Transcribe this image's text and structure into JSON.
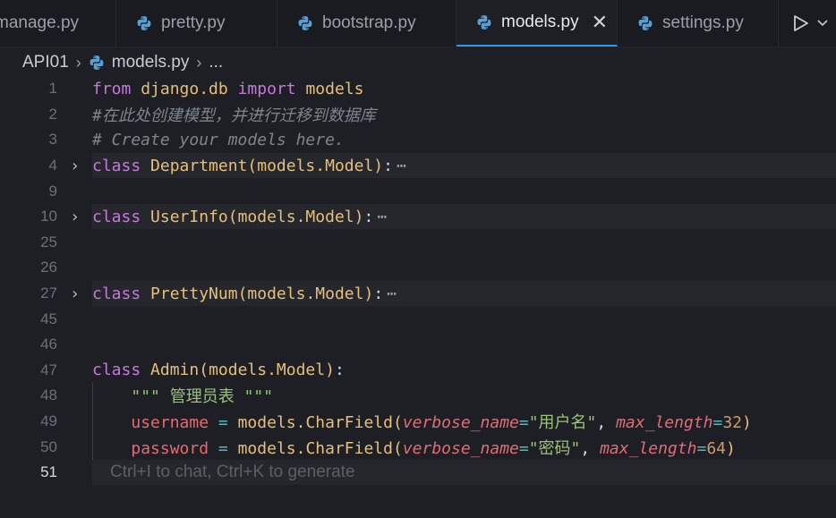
{
  "tabs": [
    {
      "label": "manage.py",
      "active": false
    },
    {
      "label": "pretty.py",
      "active": false
    },
    {
      "label": "bootstrap.py",
      "active": false
    },
    {
      "label": "models.py",
      "active": true
    },
    {
      "label": "settings.py",
      "active": false
    }
  ],
  "breadcrumb": {
    "folder": "API01",
    "file": "models.py",
    "more": "..."
  },
  "editor": {
    "current_line": "51",
    "inline_hint": "Ctrl+I to chat, Ctrl+K to generate",
    "lines": [
      {
        "num": "1"
      },
      {
        "num": "2",
        "text": "#在此处创建模型，并进行迁移到数据库"
      },
      {
        "num": "3",
        "text": "# Create your models here."
      },
      {
        "num": "4"
      },
      {
        "num": "9"
      },
      {
        "num": "10"
      },
      {
        "num": "25"
      },
      {
        "num": "26"
      },
      {
        "num": "27"
      },
      {
        "num": "45"
      },
      {
        "num": "46"
      },
      {
        "num": "47"
      },
      {
        "num": "48"
      },
      {
        "num": "49"
      },
      {
        "num": "50"
      },
      {
        "num": "51"
      }
    ]
  },
  "code": {
    "from": "from",
    "django_db": "django.db",
    "import": "import",
    "models": "models",
    "class": "class",
    "department": "Department",
    "userinfo": "UserInfo",
    "prettynum": "PrettyNum",
    "admin": "Admin",
    "base": "models.Model",
    "docstring_q": "\"\"\"",
    "docstring_text": " 管理员表 ",
    "username": "username",
    "password": "password",
    "charfield": "models.CharField",
    "verbose_name": "verbose_name",
    "max_length": "max_length",
    "username_label": "\"用户名\"",
    "password_label": "\"密码\"",
    "len32": "32",
    "len64": "64",
    "ellipsis": "⋯"
  },
  "colors": {
    "accent": "#3b8eea",
    "keyword": "#c678dd",
    "class_name": "#e5c07b",
    "string": "#98c379",
    "variable": "#e06c75",
    "number": "#d19a66"
  }
}
